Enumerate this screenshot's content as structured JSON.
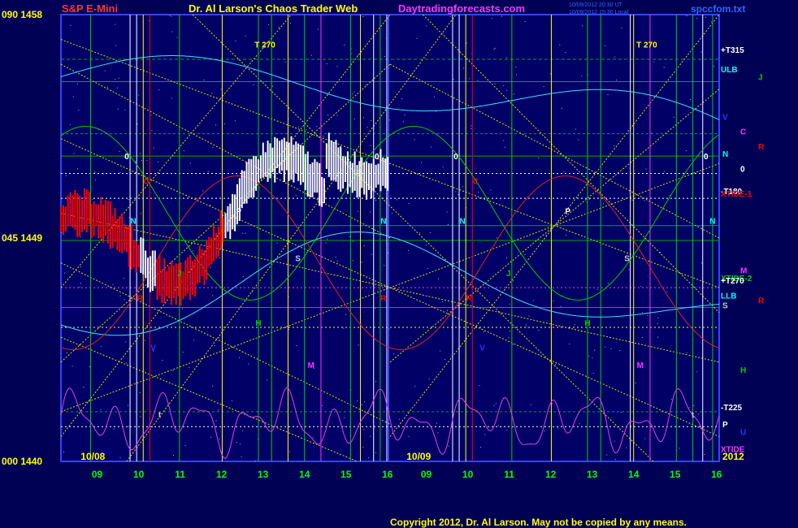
{
  "header": {
    "instrument": "S&P E-Mini",
    "title": "Dr. Al Larson's Chaos Trader Web",
    "site": "Daytradingforecasts.com",
    "timestamp1": "10/09/2012 20:30 UT",
    "timestamp2": "10/09/2012 15:30 Local",
    "filename": "spccfom.txt"
  },
  "footer": {
    "copyright": "Copyright 2012, Dr. Al Larson. May not be copied by any means."
  },
  "colors": {
    "background": "#000055",
    "plot_bg": "#000066",
    "border": "#3344ff",
    "yellow": "#ffff00",
    "red": "#ff0000",
    "magenta": "#ff33ff",
    "cyan": "#00ffff",
    "green": "#00cc00"
  },
  "chart_data": {
    "type": "line",
    "ylim": [
      1440,
      1458
    ],
    "y_ticks": [
      {
        "value": 1458,
        "label": "090 1458"
      },
      {
        "value": 1449,
        "label": "045 1449"
      },
      {
        "value": 1440,
        "label": "000 1440"
      }
    ],
    "x_hours": [
      "09",
      "10",
      "11",
      "12",
      "13",
      "14",
      "15",
      "16",
      "09",
      "10",
      "11",
      "12",
      "13",
      "14",
      "15",
      "16"
    ],
    "date_labels": [
      "10/08",
      "10/09"
    ],
    "year_label": "2012",
    "right_labels": [
      {
        "text": "+T315",
        "value": 1456.6,
        "color": "#ffffff"
      },
      {
        "text": "ULB",
        "value": 1455.8,
        "color": "#00ffff"
      },
      {
        "text": "J",
        "value": 1455.5,
        "color": "#00cc00"
      },
      {
        "text": "V",
        "value": 1453.9,
        "color": "#3333ff"
      },
      {
        "text": "C",
        "value": 1453.3,
        "color": "#ff33ff"
      },
      {
        "text": "R",
        "value": 1452.7,
        "color": "#ff0000"
      },
      {
        "text": "N",
        "value": 1452.4,
        "color": "#00ffff"
      },
      {
        "text": "0",
        "value": 1451.8,
        "color": "#ffffff"
      },
      {
        "text": "-T180",
        "value": 1450.9,
        "color": "#ffffff"
      },
      {
        "text": "XTIDE-1",
        "value": 1450.8,
        "color": "#ff0000"
      },
      {
        "text": "M",
        "value": 1447.7,
        "color": "#ff33ff"
      },
      {
        "text": "XTIDE-2",
        "value": 1447.4,
        "color": "#00cc00"
      },
      {
        "text": "+T270",
        "value": 1447.3,
        "color": "#ffffff"
      },
      {
        "text": "LLB",
        "value": 1446.7,
        "color": "#00ffff"
      },
      {
        "text": "R",
        "value": 1446.5,
        "color": "#ff0000"
      },
      {
        "text": "S",
        "value": 1446.3,
        "color": "#cccccc"
      },
      {
        "text": "H",
        "value": 1443.7,
        "color": "#00cc00"
      },
      {
        "text": "-T225",
        "value": 1442.2,
        "color": "#ffffff"
      },
      {
        "text": "P",
        "value": 1441.5,
        "color": "#ffffff"
      },
      {
        "text": "U",
        "value": 1441.2,
        "color": "#3333ff"
      },
      {
        "text": "XTIDE",
        "value": 1440.5,
        "color": "#ff33ff"
      }
    ],
    "in_plot_labels": [
      {
        "text": "T   270",
        "xi": 0.31,
        "value": 1456.8,
        "color": "#ffff00"
      },
      {
        "text": "T   270",
        "xi": 0.89,
        "value": 1456.8,
        "color": "#ffff00"
      },
      {
        "text": "0",
        "xi": 0.1,
        "value": 1452.3,
        "color": "#ffffff"
      },
      {
        "text": "0",
        "xi": 0.48,
        "value": 1452.3,
        "color": "#ffffff"
      },
      {
        "text": "0",
        "xi": 0.6,
        "value": 1452.3,
        "color": "#ffffff"
      },
      {
        "text": "0",
        "xi": 0.98,
        "value": 1452.3,
        "color": "#ffffff"
      },
      {
        "text": "C",
        "xi": 0.13,
        "value": 1451.3,
        "color": "#ff0000"
      },
      {
        "text": "C",
        "xi": 0.63,
        "value": 1451.3,
        "color": "#ff0000"
      },
      {
        "text": "P",
        "xi": 0.27,
        "value": 1450.1,
        "color": "#ffffff"
      },
      {
        "text": "P",
        "xi": 0.77,
        "value": 1450.1,
        "color": "#ffffff"
      },
      {
        "text": "N",
        "xi": 0.11,
        "value": 1449.7,
        "color": "#00ffff"
      },
      {
        "text": "N",
        "xi": 0.49,
        "value": 1449.7,
        "color": "#00ffff"
      },
      {
        "text": "N",
        "xi": 0.61,
        "value": 1449.7,
        "color": "#00ffff"
      },
      {
        "text": "N",
        "xi": 0.99,
        "value": 1449.7,
        "color": "#00ffff"
      },
      {
        "text": "S",
        "xi": 0.36,
        "value": 1448.2,
        "color": "#cccccc"
      },
      {
        "text": "S",
        "xi": 0.86,
        "value": 1448.2,
        "color": "#cccccc"
      },
      {
        "text": "J",
        "xi": 0.18,
        "value": 1447.6,
        "color": "#00cc00"
      },
      {
        "text": "J",
        "xi": 0.68,
        "value": 1447.6,
        "color": "#00cc00"
      },
      {
        "text": "R",
        "xi": 0.12,
        "value": 1446.6,
        "color": "#ff0000"
      },
      {
        "text": "R",
        "xi": 0.49,
        "value": 1446.6,
        "color": "#ff0000"
      },
      {
        "text": "R",
        "xi": 0.62,
        "value": 1446.6,
        "color": "#ff0000"
      },
      {
        "text": "H",
        "xi": 0.3,
        "value": 1445.6,
        "color": "#00cc00"
      },
      {
        "text": "H",
        "xi": 0.8,
        "value": 1445.6,
        "color": "#00cc00"
      },
      {
        "text": "V",
        "xi": 0.14,
        "value": 1444.6,
        "color": "#3333ff"
      },
      {
        "text": "V",
        "xi": 0.64,
        "value": 1444.6,
        "color": "#3333ff"
      },
      {
        "text": "M",
        "xi": 0.38,
        "value": 1443.9,
        "color": "#ff33ff"
      },
      {
        "text": "M",
        "xi": 0.88,
        "value": 1443.9,
        "color": "#ff33ff"
      },
      {
        "text": "t",
        "xi": 0.15,
        "value": 1441.9,
        "color": "#cccccc"
      },
      {
        "text": "t",
        "xi": 0.96,
        "value": 1441.9,
        "color": "#cccccc"
      }
    ]
  }
}
